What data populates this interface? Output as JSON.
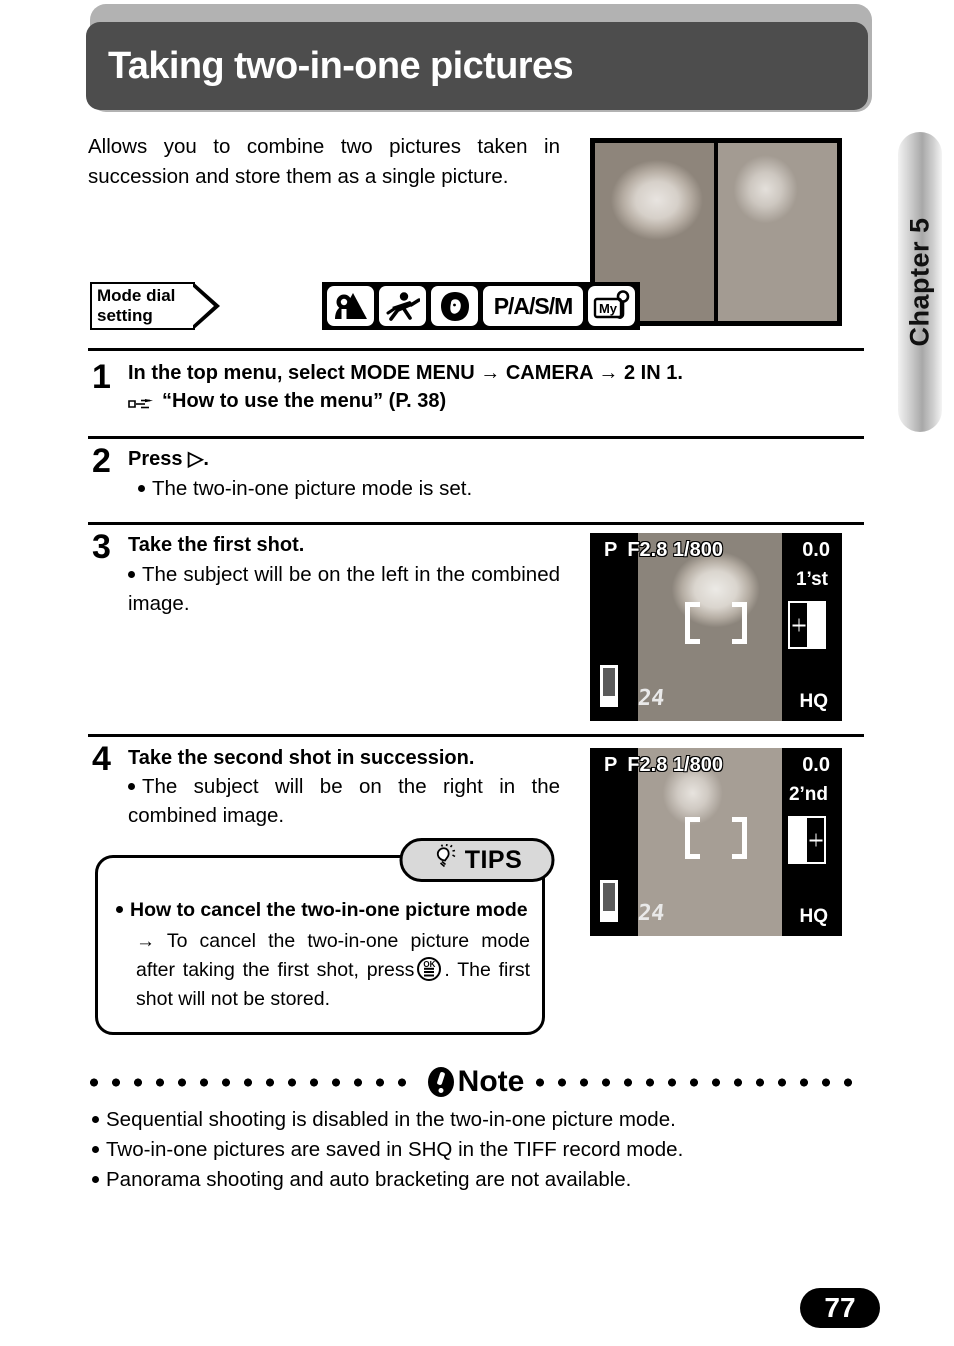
{
  "header": {
    "title": "Taking two-in-one pictures"
  },
  "chapter_tab": {
    "label": "Chapter 5"
  },
  "intro": {
    "text": "Allows you to combine two pictures taken in succession and store them as a single picture."
  },
  "mode_dial": {
    "flag_line1": "Mode dial",
    "flag_line2": "setting",
    "icons": [
      {
        "name": "landscape-portrait-mode-icon",
        "label": ""
      },
      {
        "name": "sports-mode-icon",
        "label": ""
      },
      {
        "name": "portrait-mode-icon",
        "label": ""
      },
      {
        "name": "pasm-mode-icon",
        "label": "P/A/S/M"
      },
      {
        "name": "my-mode-icon",
        "label": "My"
      }
    ]
  },
  "steps": [
    {
      "number": "1",
      "heading": "In the top menu, select MODE MENU → CAMERA → 2 IN 1.",
      "reference": "“How to use the menu” (P. 38)",
      "bullets": []
    },
    {
      "number": "2",
      "heading": "Press ▷.",
      "bullets": [
        "The two-in-one picture mode is set."
      ]
    },
    {
      "number": "3",
      "heading": "Take the first shot.",
      "bullets": [
        "The subject will be on the left in the combined image."
      ]
    },
    {
      "number": "4",
      "heading": "Take the second shot in succession.",
      "bullets": [
        "The subject will be on the right in the combined image."
      ]
    }
  ],
  "lcd_first": {
    "mode": "P",
    "exposure": "F2.8 1/800",
    "ev": "0.0",
    "order": "1’st",
    "quality": "HQ",
    "frames_remaining": "24",
    "indicator_filled_side": "left"
  },
  "lcd_second": {
    "mode": "P",
    "exposure": "F2.8 1/800",
    "ev": "0.0",
    "order": "2’nd",
    "quality": "HQ",
    "frames_remaining": "24",
    "indicator_filled_side": "right"
  },
  "tips": {
    "badge_label": "TIPS",
    "badge_icon": "lightbulb-icon",
    "title": "How to cancel the two-in-one picture mode",
    "detail_prefix": "To cancel the two-in-one picture mode after taking the first shot, press",
    "detail_suffix": ". The first shot will not be stored.",
    "button_icon": "ok-button-icon",
    "button_label": "OK"
  },
  "note": {
    "label": "Note",
    "icon": "exclamation-icon",
    "items": [
      "Sequential shooting is disabled in the two-in-one picture mode.",
      "Two-in-one pictures are saved in SHQ in the TIFF record mode.",
      "Panorama shooting and auto bracketing are not available."
    ]
  },
  "footer": {
    "page_number": "77"
  },
  "colors": {
    "title_bar": "#4d4d4d",
    "title_shadow": "#b2b2b2",
    "tips_badge": "#d9d9d9",
    "page_pill": "#000000"
  }
}
